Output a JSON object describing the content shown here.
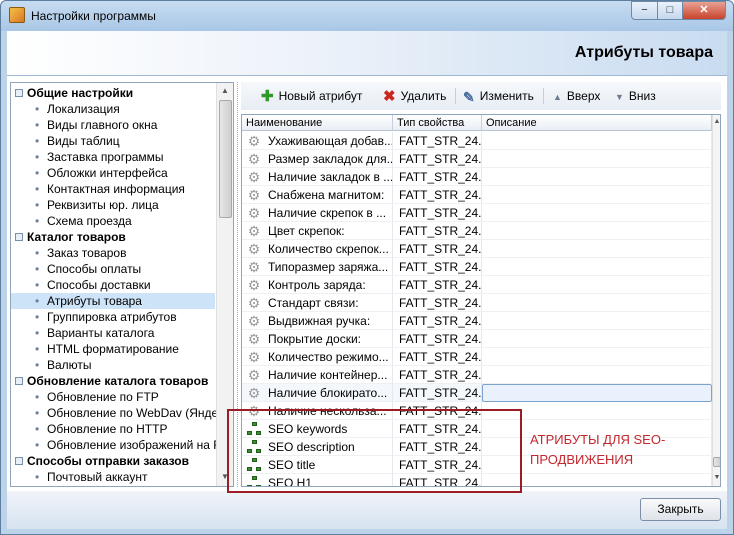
{
  "window": {
    "title": "Настройки программы",
    "controls": {
      "minimize": "−",
      "maximize": "□",
      "close": "✕"
    }
  },
  "header": {
    "title": "Атрибуты товара"
  },
  "sidebar": {
    "groups": [
      {
        "label": "Общие настройки",
        "items": [
          "Локализация",
          "Виды главного окна",
          "Виды таблиц",
          "Заставка программы",
          "Обложки интерфейса",
          "Контактная информация",
          "Реквизиты юр. лица",
          "Схема проезда"
        ]
      },
      {
        "label": "Каталог товаров",
        "items": [
          "Заказ товаров",
          "Способы оплаты",
          "Способы доставки",
          "Атрибуты товара",
          "Группировка атрибутов",
          "Варианты каталога",
          "HTML форматирование",
          "Валюты"
        ]
      },
      {
        "label": "Обновление каталога товаров",
        "items": [
          "Обновление по FTP",
          "Обновление по WebDav (Яндекс",
          "Обновление по HTTP",
          "Обновление изображений на FTP"
        ]
      },
      {
        "label": "Способы отправки заказов",
        "items": [
          "Почтовый аккаунт"
        ]
      }
    ],
    "selected": "Атрибуты товара"
  },
  "toolbar": {
    "new_label": "Новый атрибут",
    "delete_label": "Удалить",
    "edit_label": "Изменить",
    "up_label": "Вверх",
    "down_label": "Вниз"
  },
  "grid": {
    "columns": [
      "Наименование",
      "Тип свойства",
      "Описание"
    ],
    "rows": [
      {
        "name": "Ухаживающая добав...",
        "type": "FATT_STR_24...",
        "desc": "",
        "icon": "gear"
      },
      {
        "name": "Размер закладок для...",
        "type": "FATT_STR_24...",
        "desc": "",
        "icon": "gear"
      },
      {
        "name": "Наличие закладок в ...",
        "type": "FATT_STR_24...",
        "desc": "",
        "icon": "gear"
      },
      {
        "name": "Снабжена магнитом:",
        "type": "FATT_STR_24...",
        "desc": "",
        "icon": "gear"
      },
      {
        "name": "Наличие скрепок в ...",
        "type": "FATT_STR_24...",
        "desc": "",
        "icon": "gear"
      },
      {
        "name": "Цвет скрепок:",
        "type": "FATT_STR_24...",
        "desc": "",
        "icon": "gear"
      },
      {
        "name": "Количество скрепок...",
        "type": "FATT_STR_24...",
        "desc": "",
        "icon": "gear"
      },
      {
        "name": "Типоразмер заряжа...",
        "type": "FATT_STR_24...",
        "desc": "",
        "icon": "gear"
      },
      {
        "name": "Контроль заряда:",
        "type": "FATT_STR_24...",
        "desc": "",
        "icon": "gear"
      },
      {
        "name": "Стандарт связи:",
        "type": "FATT_STR_24...",
        "desc": "",
        "icon": "gear"
      },
      {
        "name": "Выдвижная ручка:",
        "type": "FATT_STR_24...",
        "desc": "",
        "icon": "gear"
      },
      {
        "name": "Покрытие доски:",
        "type": "FATT_STR_24...",
        "desc": "",
        "icon": "gear"
      },
      {
        "name": "Количество режимо...",
        "type": "FATT_STR_24...",
        "desc": "",
        "icon": "gear"
      },
      {
        "name": "Наличие контейнер...",
        "type": "FATT_STR_24...",
        "desc": "",
        "icon": "gear"
      },
      {
        "name": "Наличие блокирато...",
        "type": "FATT_STR_24...",
        "desc": "",
        "icon": "gear",
        "selected": true
      },
      {
        "name": "Наличие нескольза...",
        "type": "FATT_STR_24...",
        "desc": "",
        "icon": "gear"
      },
      {
        "name": "SEO keywords",
        "type": "FATT_STR_24...",
        "desc": "",
        "icon": "tree"
      },
      {
        "name": "SEO description",
        "type": "FATT_STR_24...",
        "desc": "",
        "icon": "tree"
      },
      {
        "name": "SEO title",
        "type": "FATT_STR_24...",
        "desc": "",
        "icon": "tree"
      },
      {
        "name": "SEO H1",
        "type": "FATT_STR_24...",
        "desc": "",
        "icon": "tree"
      }
    ]
  },
  "annotation": {
    "text": "АТРИБУТЫ ДЛЯ SEO-ПРОДВИЖЕНИЯ",
    "color": "#c3272e"
  },
  "footer": {
    "close_label": "Закрыть"
  }
}
